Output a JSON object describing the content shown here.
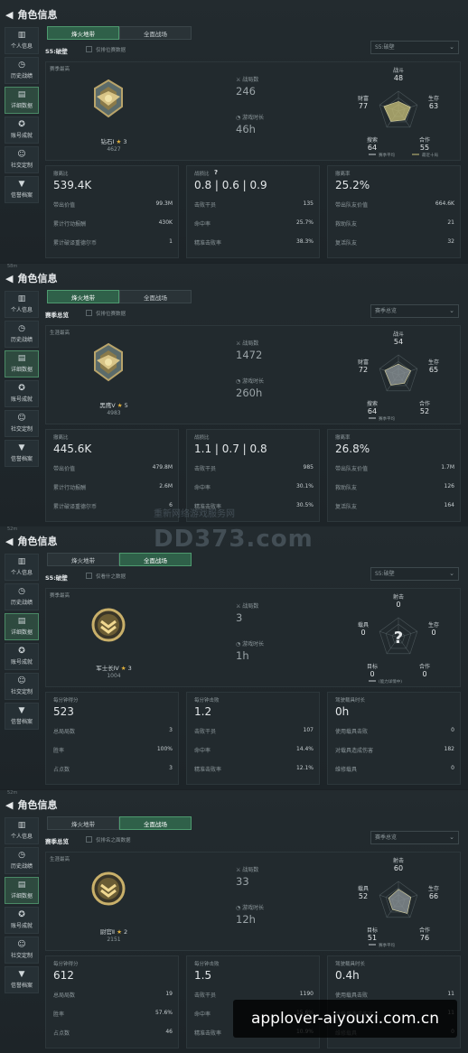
{
  "status_snips": [
    "",
    "58m",
    "52m",
    "52m"
  ],
  "title": "角色信息",
  "sidebar": [
    "个人信息",
    "历史战绩",
    "详细数据",
    "账号成就",
    "社交定制",
    "信誉档案"
  ],
  "panels": [
    {
      "tabs": [
        "烽火地带",
        "全面战场"
      ],
      "active_tab": 0,
      "season_label": "S5:破壁",
      "checkbox_label": "仅排位赛数据",
      "dropdown": "S5:破壁",
      "card_caption": "赛季最高",
      "rank_name": "钻石Ⅰ",
      "rank_stars": "3",
      "rank_points": "4627",
      "mid1_label": "战局数",
      "mid1_value": "246",
      "mid2_label": "游戏时长",
      "mid2_value": "46h",
      "radar": {
        "labels": [
          "战斗",
          "生存",
          "合作",
          "搜索",
          "财富"
        ],
        "values": [
          "48",
          "63",
          "55",
          "64",
          "77"
        ],
        "fill": [
          0.48,
          0.63,
          0.55,
          0.64,
          0.77
        ],
        "legend": [
          "赛季平均",
          "最近十局"
        ]
      },
      "stats": [
        {
          "head": "撤离比",
          "big": "539.4K",
          "rows": [
            [
              "带出价值",
              "99.3M"
            ],
            [
              "累计行动报酬",
              "430K"
            ],
            [
              "累计破译重德尔币",
              "1"
            ]
          ]
        },
        {
          "head": "战损比",
          "big": "0.8 | 0.6 | 0.9",
          "rows": [
            [
              "击败干员",
              "135"
            ],
            [
              "命中率",
              "25.7%"
            ],
            [
              "精准击败率",
              "38.3%"
            ]
          ]
        },
        {
          "head": "撤离率",
          "big": "25.2%",
          "rows": [
            [
              "带出队友价值",
              "664.6K"
            ],
            [
              "救助队友",
              "21"
            ],
            [
              "复活队友",
              "32"
            ]
          ]
        }
      ]
    },
    {
      "tabs": [
        "烽火地带",
        "全面战场"
      ],
      "active_tab": 0,
      "season_label": "赛季总览",
      "checkbox_label": "仅排位赛数据",
      "dropdown": "赛季总览",
      "card_caption": "生涯最高",
      "rank_name": "黑鹰Ⅴ",
      "rank_stars": "5",
      "rank_points": "4983",
      "mid1_label": "战局数",
      "mid1_value": "1472",
      "mid2_label": "游戏时长",
      "mid2_value": "260h",
      "radar": {
        "labels": [
          "战斗",
          "生存",
          "合作",
          "搜索",
          "财富"
        ],
        "values": [
          "54",
          "65",
          "52",
          "64",
          "72"
        ],
        "fill": [
          0.54,
          0.65,
          0.52,
          0.64,
          0.72
        ],
        "legend": [
          "赛季平均"
        ]
      },
      "stats": [
        {
          "head": "撤离比",
          "big": "445.6K",
          "rows": [
            [
              "带出价值",
              "479.8M"
            ],
            [
              "累计行动报酬",
              "2.6M"
            ],
            [
              "累计破译重德尔币",
              "6"
            ]
          ]
        },
        {
          "head": "战损比",
          "big": "1.1 | 0.7 | 0.8",
          "rows": [
            [
              "击败干员",
              "985"
            ],
            [
              "命中率",
              "30.1%"
            ],
            [
              "精准击败率",
              "30.5%"
            ]
          ]
        },
        {
          "head": "撤离率",
          "big": "26.8%",
          "rows": [
            [
              "带出队友价值",
              "1.7M"
            ],
            [
              "救助队友",
              "126"
            ],
            [
              "复活队友",
              "164"
            ]
          ]
        }
      ]
    },
    {
      "tabs": [
        "烽火地带",
        "全面战场"
      ],
      "active_tab": 1,
      "season_label": "S5:破壁",
      "checkbox_label": "仅看什之数据",
      "dropdown": "S5:破壁",
      "card_caption": "赛季最高",
      "rank_name": "军士长Ⅳ",
      "rank_stars": "3",
      "rank_points": "1004",
      "mid1_label": "战局数",
      "mid1_value": "3",
      "mid2_label": "游戏时长",
      "mid2_value": "1h",
      "radar": {
        "labels": [
          "射击",
          "生存",
          "合作",
          "目标",
          "载具"
        ],
        "values": [
          "0",
          "0",
          "0",
          "0",
          "0"
        ],
        "fill": [
          0,
          0,
          0,
          0,
          0
        ],
        "legend": [
          "(能力详情中)"
        ],
        "question": "?"
      },
      "stats": [
        {
          "head": "每分钟得分",
          "big": "523",
          "rows": [
            [
              "总局局数",
              "3"
            ],
            [
              "胜率",
              "100%"
            ],
            [
              "占点数",
              "3"
            ]
          ]
        },
        {
          "head": "每分钟击败",
          "big": "1.2",
          "rows": [
            [
              "击败干员",
              "107"
            ],
            [
              "命中率",
              "14.4%"
            ],
            [
              "精准击败率",
              "12.1%"
            ]
          ]
        },
        {
          "head": "驾驶载具时长",
          "big": "0h",
          "rows": [
            [
              "使用载具击败",
              "0"
            ],
            [
              "对载具造成伤害",
              "182"
            ],
            [
              "维修载具",
              "0"
            ]
          ]
        }
      ]
    },
    {
      "tabs": [
        "烽火地带",
        "全面战场"
      ],
      "active_tab": 1,
      "season_label": "赛季总览",
      "checkbox_label": "仅排名之面数据",
      "dropdown": "赛季总览",
      "card_caption": "生涯最高",
      "rank_name": "尉官Ⅱ",
      "rank_stars": "2",
      "rank_points": "2151",
      "mid1_label": "战局数",
      "mid1_value": "33",
      "mid2_label": "游戏时长",
      "mid2_value": "12h",
      "radar": {
        "labels": [
          "射击",
          "生存",
          "合作",
          "目标",
          "载具"
        ],
        "values": [
          "60",
          "66",
          "76",
          "51",
          "52"
        ],
        "fill": [
          0.6,
          0.66,
          0.76,
          0.51,
          0.52
        ],
        "legend": [
          "赛季平均"
        ]
      },
      "stats": [
        {
          "head": "每分钟得分",
          "big": "612",
          "rows": [
            [
              "总局局数",
              "19"
            ],
            [
              "胜率",
              "57.6%"
            ],
            [
              "占点数",
              "46"
            ]
          ]
        },
        {
          "head": "每分钟击败",
          "big": "1.5",
          "rows": [
            [
              "击败干员",
              "1190"
            ],
            [
              "命中率",
              "15.6%"
            ],
            [
              "精准击败率",
              "10.9%"
            ]
          ]
        },
        {
          "head": "驾驶载具时长",
          "big": "0.4h",
          "rows": [
            [
              "使用载具击败",
              "11"
            ],
            [
              "对载具造成伤害",
              "11"
            ],
            [
              "维修载具",
              "0"
            ]
          ]
        }
      ]
    }
  ],
  "watermark": "DD373.com",
  "watermark_sub": "重新网络游戏服务网",
  "footer": "applover-aiyouxi.com.cn",
  "colors": {
    "accent_tab": "#2f6049",
    "radar_fill": "#c9c27a",
    "star": "#e3b13a"
  }
}
